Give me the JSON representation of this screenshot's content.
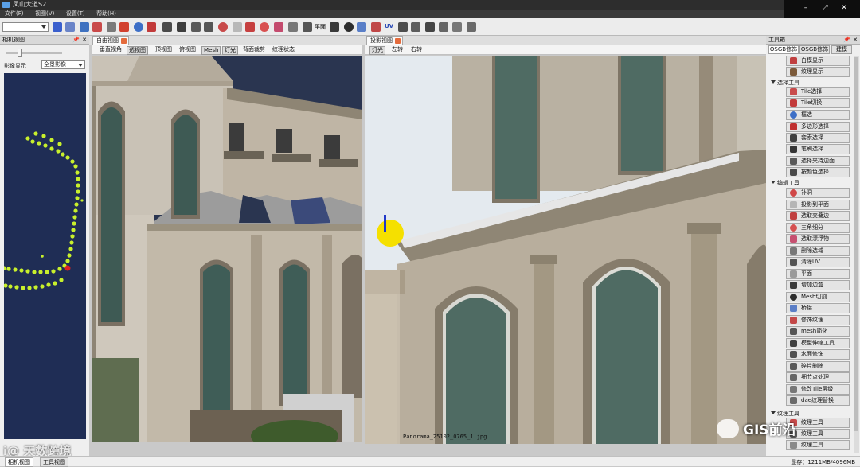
{
  "window": {
    "title": "凤山大道S2"
  },
  "menu": [
    "文件(F)",
    "视图(V)",
    "设置(T)",
    "帮助(H)"
  ],
  "toolbar": {
    "uv_label": "UV"
  },
  "camera_panel": {
    "title": "相机视图",
    "image_display_label": "影像显示",
    "image_display_value": "全景影像"
  },
  "free_view": {
    "tab": "自由视图",
    "buttons": [
      "垂直视角",
      "透视图",
      "顶视图",
      "俯视图",
      "Mesh",
      "灯光",
      "背面裁剪",
      "纹理状态"
    ],
    "active": "透视图"
  },
  "projection_view": {
    "tab": "投影视图",
    "buttons": [
      "灯光",
      "左转",
      "右转"
    ],
    "overlay_filename": "Panorama_25102_0765_1.jpg"
  },
  "toolbox": {
    "title": "工具箱",
    "tabs": [
      "OSGB修饰",
      "OSGB修饰",
      "建模"
    ],
    "display_tools": [
      "白模显示",
      "纹理显示"
    ],
    "select_group": "选择工具",
    "select_tools": [
      "Tile选择",
      "Tile切换",
      "框选",
      "多边形选择",
      "套索选择",
      "笔刷选择",
      "选择夹持边面",
      "按颜色选择"
    ],
    "edit_group": "编辑工具",
    "edit_tools": [
      "补洞",
      "投影到平面",
      "选取交叠边",
      "三角细分",
      "选取漂浮物",
      "删除选域",
      "清除UV",
      "平面",
      "增加边盒",
      "Mesh切割",
      "桥接",
      "修饰纹理",
      "mesh简化",
      "模型伸缩工具",
      "水面修饰",
      "碎片删除",
      "细节点处理",
      "修改Tile层级",
      "dae纹理替换"
    ],
    "texture_group": "纹理工具",
    "texture_tools": [
      "纹理工具",
      "纹理工具",
      "纹理工具"
    ]
  },
  "bottom_tabs": [
    "相机视图",
    "工具视图"
  ],
  "status": {
    "memory": "显存：1211MB/4096MB"
  },
  "watermarks": {
    "left": "i@ 天数跨境",
    "right": "GIS前沿"
  },
  "colors": {
    "free_view_sky": "#2a3550",
    "camera_bg": "#1f2d55",
    "trajectory_point": "#c8f02c",
    "highlight_dot": "#f5e000"
  }
}
